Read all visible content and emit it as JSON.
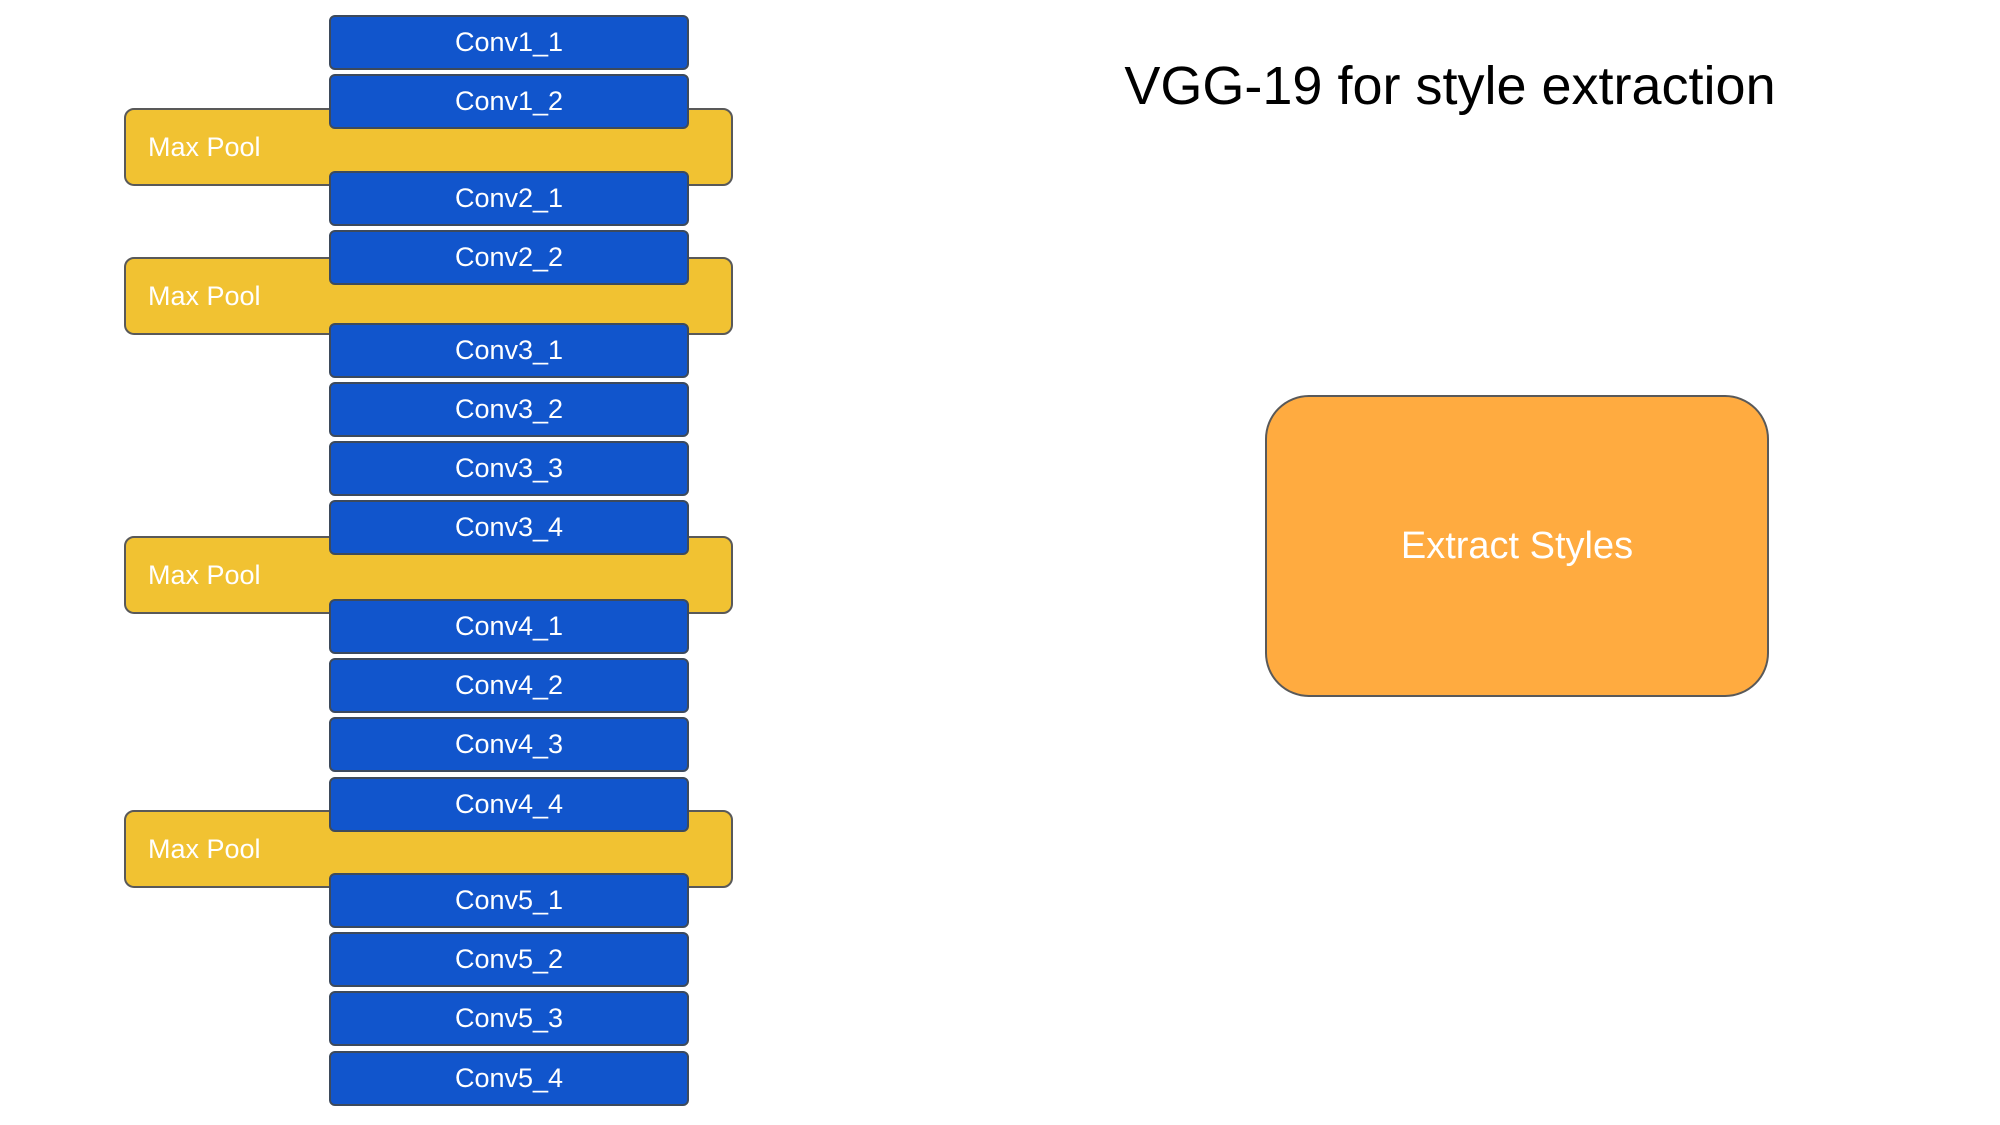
{
  "title": "VGG-19 for style extraction",
  "pool_label": "Max Pool",
  "pools": [
    "Max Pool",
    "Max Pool",
    "Max Pool",
    "Max Pool"
  ],
  "layers": [
    "Conv1_1",
    "Conv1_2",
    "Conv2_1",
    "Conv2_2",
    "Conv3_1",
    "Conv3_2",
    "Conv3_3",
    "Conv3_4",
    "Conv4_1",
    "Conv4_2",
    "Conv4_3",
    "Conv4_4",
    "Conv5_1",
    "Conv5_2",
    "Conv5_3",
    "Conv5_4"
  ],
  "extract_box": {
    "label": "Extract Styles"
  },
  "colors": {
    "conv_fill": "#1155cc",
    "pool_fill": "#f1c232",
    "extract_fill": "#ffab40",
    "text_light": "#ffffff",
    "title_text": "#000000"
  }
}
